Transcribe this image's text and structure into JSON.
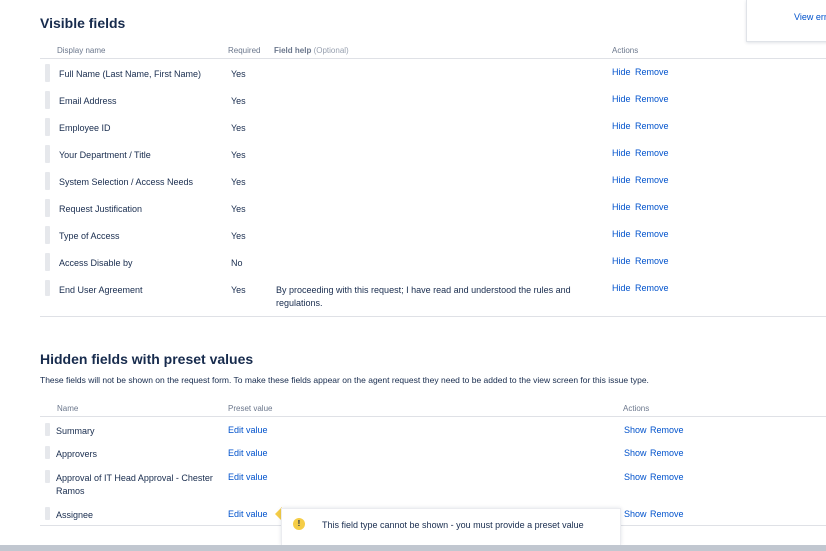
{
  "top_panel": {
    "link": "View err"
  },
  "visible": {
    "title": "Visible fields",
    "headers": {
      "name": "Display name",
      "required": "Required",
      "help": "Field help",
      "help_optional": "(Optional)",
      "actions": "Actions"
    },
    "rows": [
      {
        "name": "Full Name (Last Name, First Name)",
        "required": "Yes",
        "help": "",
        "hide": "Hide",
        "remove": "Remove"
      },
      {
        "name": "Email Address",
        "required": "Yes",
        "help": "",
        "hide": "Hide",
        "remove": "Remove"
      },
      {
        "name": "Employee ID",
        "required": "Yes",
        "help": "",
        "hide": "Hide",
        "remove": "Remove"
      },
      {
        "name": "Your Department / Title",
        "required": "Yes",
        "help": "",
        "hide": "Hide",
        "remove": "Remove"
      },
      {
        "name": "System Selection / Access Needs",
        "required": "Yes",
        "help": "",
        "hide": "Hide",
        "remove": "Remove"
      },
      {
        "name": "Request Justification",
        "required": "Yes",
        "help": "",
        "hide": "Hide",
        "remove": "Remove"
      },
      {
        "name": "Type of Access",
        "required": "Yes",
        "help": "",
        "hide": "Hide",
        "remove": "Remove"
      },
      {
        "name": "Access Disable by",
        "required": "No",
        "help": "",
        "hide": "Hide",
        "remove": "Remove"
      },
      {
        "name": "End User Agreement",
        "required": "Yes",
        "help": "By proceeding with this request; I have read and understood the rules and regulations.",
        "hide": "Hide",
        "remove": "Remove"
      }
    ]
  },
  "hidden": {
    "title": "Hidden fields with preset values",
    "description": "These fields will not be shown on the request form. To make these fields appear on the agent request they need to be added to the view screen for this issue type.",
    "headers": {
      "name": "Name",
      "preset": "Preset value",
      "actions": "Actions"
    },
    "rows": [
      {
        "name": "Summary",
        "preset": "Edit value",
        "show": "Show",
        "remove": "Remove"
      },
      {
        "name": "Approvers",
        "preset": "Edit value",
        "show": "Show",
        "remove": "Remove"
      },
      {
        "name": "Approval of IT Head Approval - Chester Ramos",
        "preset": "Edit value",
        "show": "Show",
        "remove": "Remove"
      },
      {
        "name": "Assignee",
        "preset": "Edit value",
        "show": "Show",
        "remove": "Remove"
      }
    ]
  },
  "tooltip": {
    "icon": "warning-icon",
    "text": "This field type cannot be shown - you must provide a preset value",
    "color": "#f5cd47"
  }
}
